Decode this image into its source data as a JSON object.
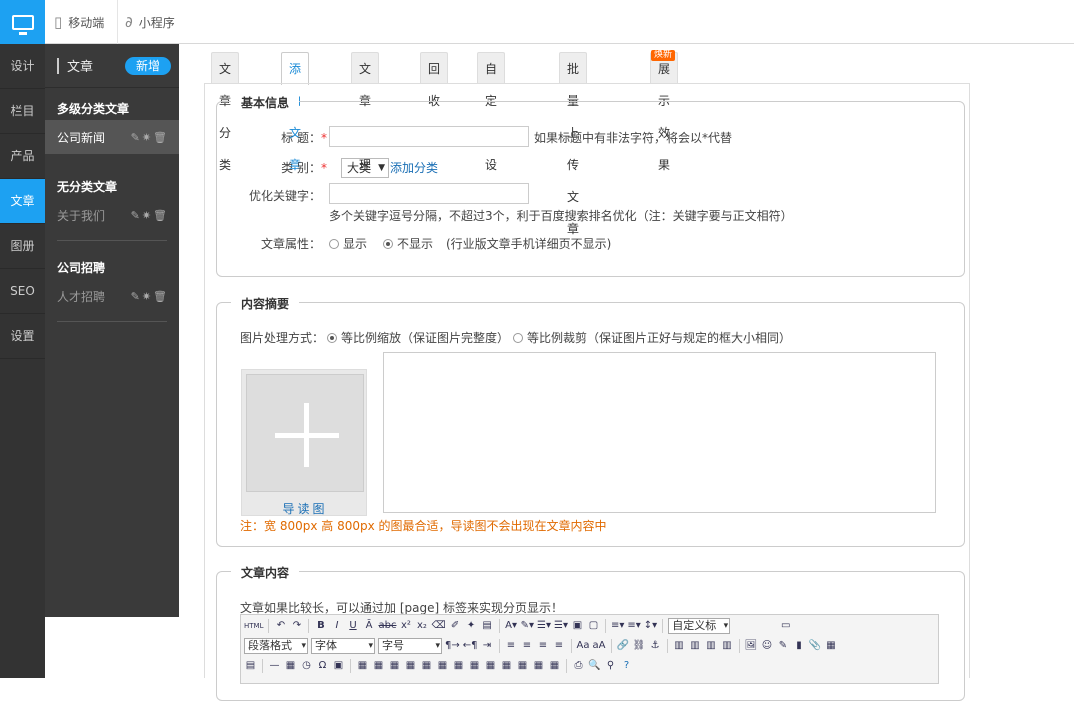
{
  "topbar": {
    "mobile": "移动端",
    "miniprogram": "小程序"
  },
  "nav": [
    {
      "label": "设计"
    },
    {
      "label": "栏目"
    },
    {
      "label": "产品"
    },
    {
      "label": "文章"
    },
    {
      "label": "图册"
    },
    {
      "label": "SEO"
    },
    {
      "label": "设置"
    }
  ],
  "sub": {
    "title": "文章",
    "new_button": "新增",
    "groups": [
      {
        "name": "多级分类文章",
        "items": [
          "公司新闻"
        ]
      },
      {
        "name": "无分类文章",
        "items": [
          "关于我们"
        ]
      },
      {
        "name": "公司招聘",
        "items": [
          "人才招聘"
        ]
      }
    ]
  },
  "tabs": [
    "文章分类",
    "添加文章",
    "文章管理",
    "回收站",
    "自定义设置",
    "批量上传文章",
    "展示效果"
  ],
  "tab_badge": "焕新",
  "basic": {
    "legend": "基本信息",
    "title_label": "标 题：",
    "title_hint": "如果标题中有非法字符，将会以*代替",
    "category_label": "类 别：",
    "category_value": "大类",
    "add_category": "添加分类",
    "keywords_label": "优化关键字：",
    "keywords_hint": "多个关键字逗号分隔，不超过3个，利于百度搜索排名优化（注：关键字要与正文相符）",
    "attr_label": "文章属性：",
    "attr_show": "显示",
    "attr_hide": "不显示",
    "attr_note": "(行业版文章手机详细页不显示)",
    "required_mark": "*"
  },
  "summary": {
    "legend": "内容摘要",
    "image_mode_label": "图片处理方式：",
    "mode_scale": "等比例缩放（保证图片完整度）",
    "mode_crop": "等比例裁剪（保证图片正好与规定的框大小相同）",
    "thumb_caption": "导读图",
    "note": "注：宽 800px 高 800px 的图最合适，导读图不会出现在文章内容中"
  },
  "body": {
    "legend": "文章内容",
    "hint": "文章如果比较长，可以通过加 [page] 标签来实现分页显示！",
    "toolbar": {
      "custom_title": "自定义标",
      "paragraph": "段落格式",
      "font": "字体",
      "size": "字号",
      "html_icon": "HTML"
    }
  }
}
